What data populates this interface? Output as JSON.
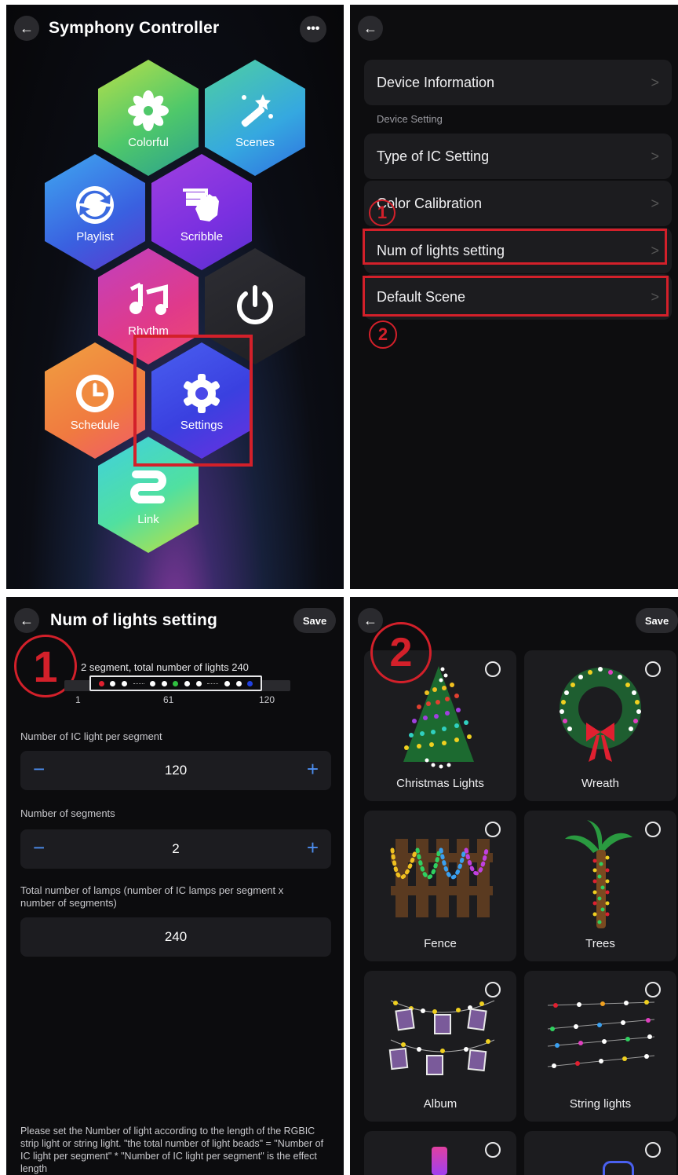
{
  "panel1": {
    "title": "Symphony Controller",
    "more_icon": "ellipsis-icon",
    "tiles": {
      "colorful": "Colorful",
      "scenes": "Scenes",
      "playlist": "Playlist",
      "scribble": "Scribble",
      "rhythm": "Rhythm",
      "power": "",
      "schedule": "Schedule",
      "settings": "Settings",
      "link": "Link"
    }
  },
  "panel2": {
    "rows": {
      "device_info": "Device Information",
      "section": "Device Setting",
      "ic_type": "Type of IC Setting",
      "color_cal": "Color Calibration",
      "num_lights": "Num of lights setting",
      "default_scene": "Default Scene"
    },
    "marker1": "1",
    "marker2": "2"
  },
  "panel3": {
    "title": "Num of lights setting",
    "save": "Save",
    "marker": "1",
    "summary": "2 segment,  total number of lights 240",
    "scale": [
      "1",
      "61",
      "120"
    ],
    "per_segment_label": "Number of IC light per segment",
    "per_segment_value": "120",
    "segments_label": "Number of segments",
    "segments_value": "2",
    "total_label": "Total number of lamps (number of IC lamps per segment x number of segments)",
    "total_value": "240",
    "minus": "−",
    "plus": "+",
    "footer": "Please set the Number of light according to the length of the RGBIC strip light or string light. \"the total number of light beads\" = \"Number of IC light per segment\" * \"Number of IC light per segment\" is the effect length"
  },
  "panel4": {
    "save": "Save",
    "marker": "2",
    "scenes": [
      "Christmas Lights",
      "Wreath",
      "Fence",
      "Trees",
      "Album",
      "String lights"
    ]
  },
  "colors": {
    "accent_red": "#d3202a",
    "accent_blue": "#4d8ef0",
    "bg": "#0d0d0f",
    "row_bg": "#1c1c1f"
  }
}
